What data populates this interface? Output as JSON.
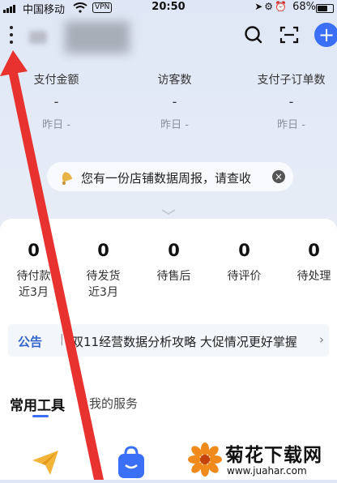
{
  "status_bar": {
    "carrier": "中国移动",
    "vpn": "VPN",
    "time": "20:50",
    "battery_percent": "68%"
  },
  "header": {
    "search_icon": "search-icon",
    "scan_icon": "scan-icon",
    "add_icon": "plus-icon",
    "add_label": "+"
  },
  "metrics": [
    {
      "label": "支付金额",
      "value": "-",
      "yesterday": "昨日 -"
    },
    {
      "label": "访客数",
      "value": "-",
      "yesterday": "昨日 -"
    },
    {
      "label": "支付子订单数",
      "value": "-",
      "yesterday": "昨日 -"
    }
  ],
  "notice": {
    "text": "您有一份店铺数据周报，请查收",
    "close": "×"
  },
  "orders": [
    {
      "count": "0",
      "label_line1": "待付款",
      "label_line2": "近3月"
    },
    {
      "count": "0",
      "label_line1": "待发货",
      "label_line2": "近3月"
    },
    {
      "count": "0",
      "label_line1": "待售后",
      "label_line2": ""
    },
    {
      "count": "0",
      "label_line1": "待评价",
      "label_line2": ""
    },
    {
      "count": "0",
      "label_line1": "待处理",
      "label_line2": ""
    }
  ],
  "announcement": {
    "tag": "公告",
    "separator": "|",
    "text": "双11经营数据分析攻略 大促情况更好掌握",
    "arrow": "›"
  },
  "tabs": {
    "active": "常用工具",
    "inactive": "我的服务"
  },
  "colors": {
    "accent": "#3b6ff6",
    "annotation_arrow": "#e8322f"
  },
  "watermark": {
    "title": "菊花下载网",
    "url": "www.juahar.com"
  }
}
